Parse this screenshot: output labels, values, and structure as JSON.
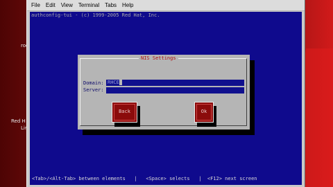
{
  "menubar": {
    "items": [
      "File",
      "Edit",
      "View",
      "Terminal",
      "Tabs",
      "Help"
    ]
  },
  "desktop": {
    "label_top": "roo",
    "label_mid": "Red H",
    "label_mid2": "Lin"
  },
  "terminal": {
    "header": "authconfig-tui - (c) 1999-2005 Red Hat, Inc.",
    "bg_color": "#0f0a8d"
  },
  "dialog": {
    "title": "NIS Settings",
    "domain_label": "Domain:",
    "domain_value": "RHCE",
    "server_label": "Server:",
    "server_value": "",
    "back_label": "Back",
    "ok_label": "Ok"
  },
  "bottom_bar": {
    "text": "<Tab>/<Alt-Tab> between elements   |   <Space> selects   |  <F12> next screen"
  },
  "colors": {
    "accent_red": "#8b0b0b",
    "terminal_blue": "#0f0a8d",
    "dialog_gray": "#b5b5b5"
  }
}
